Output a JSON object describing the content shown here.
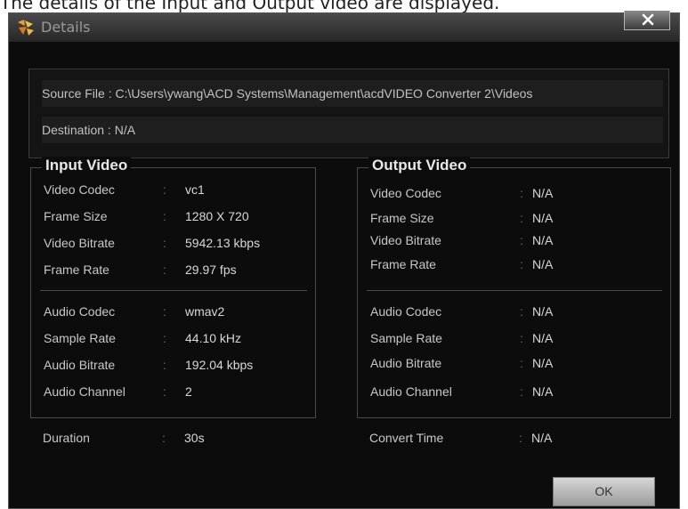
{
  "caption": "The details of the Input and Output video are displayed.",
  "window": {
    "title": "Details",
    "close_glyph": "X"
  },
  "source_file": {
    "label": "Source File :",
    "value": "C:\\Users\\ywang\\ACD Systems\\Management\\acdVIDEO Converter 2\\Videos"
  },
  "destination": {
    "label": "Destination :",
    "value": "N/A"
  },
  "input": {
    "title": "Input Video",
    "video": [
      {
        "key": "Video Codec",
        "value": "vc1"
      },
      {
        "key": "Frame Size",
        "value": "1280 X 720"
      },
      {
        "key": "Video Bitrate",
        "value": "5942.13 kbps"
      },
      {
        "key": "Frame Rate",
        "value": "29.97 fps"
      }
    ],
    "audio": [
      {
        "key": "Audio Codec",
        "value": "wmav2"
      },
      {
        "key": "Sample Rate",
        "value": "44.10 kHz"
      },
      {
        "key": "Audio Bitrate",
        "value": "192.04 kbps"
      },
      {
        "key": "Audio Channel",
        "value": "2"
      }
    ]
  },
  "output": {
    "title": "Output Video",
    "video": [
      {
        "key": "Video Codec",
        "value": "N/A"
      },
      {
        "key": "Frame Size",
        "value": "N/A"
      },
      {
        "key": "Video Bitrate",
        "value": "N/A"
      },
      {
        "key": "Frame Rate",
        "value": "N/A"
      }
    ],
    "audio": [
      {
        "key": "Audio Codec",
        "value": "N/A"
      },
      {
        "key": "Sample Rate",
        "value": "N/A"
      },
      {
        "key": "Audio Bitrate",
        "value": "N/A"
      },
      {
        "key": "Audio Channel",
        "value": "N/A"
      }
    ]
  },
  "separator": ":",
  "duration": {
    "label": "Duration",
    "value": "30s"
  },
  "convert_time": {
    "label": "Convert Time",
    "value": "N/A"
  },
  "ok_label": "OK",
  "colors": {
    "background": "#0c0c0c",
    "text": "#c8c8c8",
    "border": "#4a4a4a",
    "button": "#c0c0c0"
  },
  "icons": {
    "app": "app-logo-icon",
    "close": "close-icon"
  }
}
